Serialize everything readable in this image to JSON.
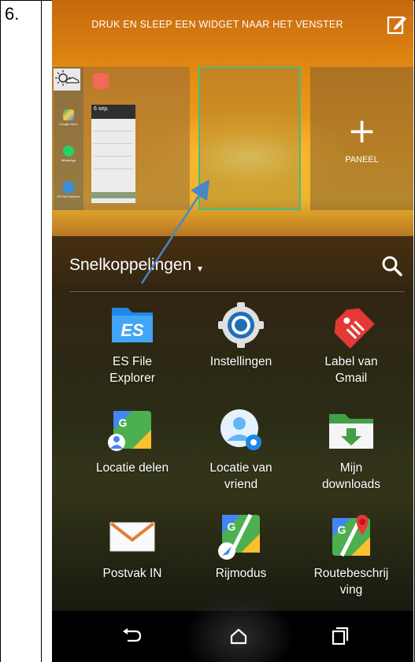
{
  "step": {
    "number": "6."
  },
  "top_bar": {
    "title": "DRUK EN SLEEP EEN WIDGET NAAR HET VENSTER",
    "edit_icon": "edit-icon"
  },
  "panels": {
    "add_panel": {
      "label": "PANEEL",
      "icon": "plus-icon"
    },
    "mini": {
      "weather_icon": "weather-icon",
      "apps": [
        {
          "name": "Google Drive",
          "color": "#1fa463"
        },
        {
          "name": "WhatsApp",
          "color": "#25d366"
        },
        {
          "name": "ES File Explorer",
          "color": "#3b8fd8"
        }
      ],
      "calendar_date": "6 sep."
    }
  },
  "section": {
    "title": "Snelkoppelingen",
    "caret": "▾",
    "search_icon": "search-icon"
  },
  "shortcuts": [
    {
      "label": "ES File Explorer",
      "icon": "es-file-explorer-icon"
    },
    {
      "label": "Instellingen",
      "icon": "settings-gear-icon"
    },
    {
      "label": "Label van Gmail",
      "icon": "gmail-label-icon"
    },
    {
      "label": "Locatie delen",
      "icon": "share-location-icon"
    },
    {
      "label": "Locatie van vriend",
      "icon": "friend-location-icon"
    },
    {
      "label": "Mijn downloads",
      "icon": "downloads-folder-icon"
    },
    {
      "label": "Postvak IN",
      "icon": "inbox-mail-icon"
    },
    {
      "label": "Rijmodus",
      "icon": "driving-mode-icon"
    },
    {
      "label": "Routebeschrijving",
      "icon": "directions-icon"
    }
  ],
  "labels_display": {
    "s0": [
      "ES File",
      "Explorer"
    ],
    "s1": [
      "Instellingen"
    ],
    "s2": [
      "Label van",
      "Gmail"
    ],
    "s3": [
      "Locatie delen"
    ],
    "s4": [
      "Locatie van",
      "vriend"
    ],
    "s5": [
      "Mijn",
      "downloads"
    ],
    "s6": [
      "Postvak IN"
    ],
    "s7": [
      "Rijmodus"
    ],
    "s8": [
      "Routebeschrij",
      "ving"
    ]
  },
  "nav": {
    "back_icon": "back-icon",
    "home_icon": "home-icon",
    "recents_icon": "recents-icon"
  },
  "colors": {
    "highlight_border": "#3fbf86",
    "arrow": "#4a86c8"
  }
}
